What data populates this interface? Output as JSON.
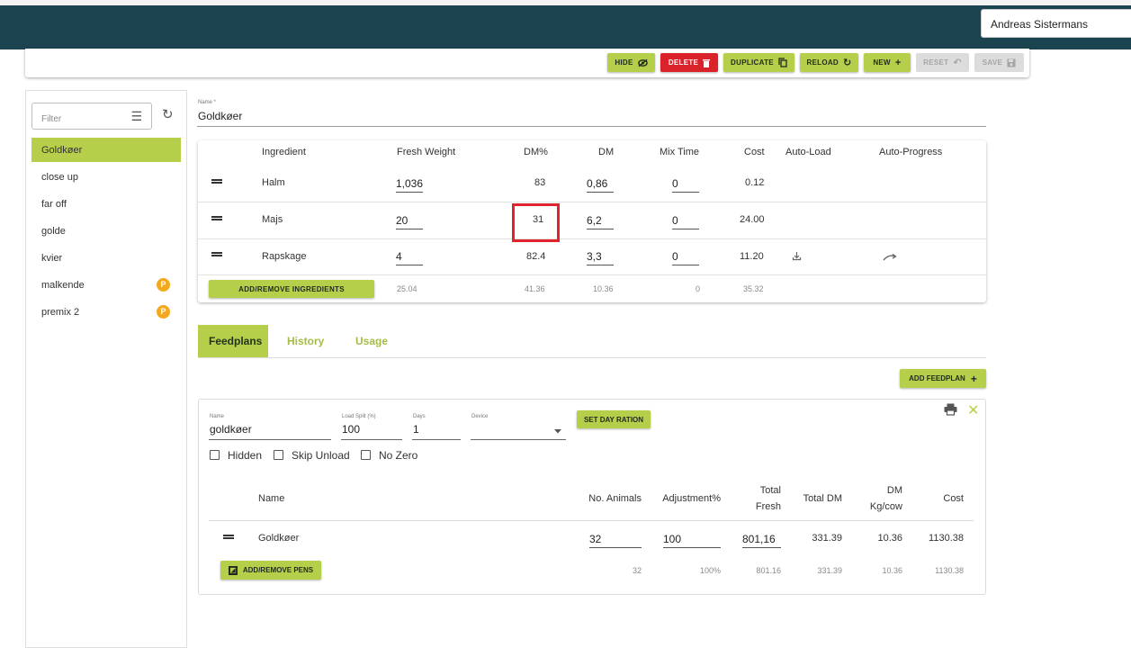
{
  "header": {
    "user_name": "Andreas Sistermans"
  },
  "toolbar": {
    "hide": "HIDE",
    "delete": "DELETE",
    "duplicate": "DUPLICATE",
    "reload": "RELOAD",
    "new": "NEW",
    "reset": "RESET",
    "save": "SAVE"
  },
  "sidebar": {
    "filter_placeholder": "Filter",
    "items": [
      {
        "label": "Goldkøer"
      },
      {
        "label": "close up"
      },
      {
        "label": "far off"
      },
      {
        "label": "golde"
      },
      {
        "label": "kvier"
      },
      {
        "label": "malkende",
        "badge": "P"
      },
      {
        "label": "premix 2",
        "badge": "P"
      }
    ]
  },
  "ration": {
    "name_label": "Name *",
    "name_value": "Goldkøer",
    "columns": [
      "Ingredient",
      "Fresh Weight",
      "DM%",
      "DM",
      "Mix Time",
      "Cost",
      "Auto-Load",
      "Auto-Progress"
    ],
    "rows": [
      {
        "ingredient": "Halm",
        "fresh_weight": "1,036",
        "dm_pct": "83",
        "dm": "0,86",
        "mix_time": "0",
        "cost": "0.12"
      },
      {
        "ingredient": "Majs",
        "fresh_weight": "20",
        "dm_pct": "31",
        "dm": "6,2",
        "mix_time": "0",
        "cost": "24.00"
      },
      {
        "ingredient": "Rapskage",
        "fresh_weight": "4",
        "dm_pct": "82.4",
        "dm": "3,3",
        "mix_time": "0",
        "cost": "11.20"
      }
    ],
    "totals": {
      "fresh_weight": "25.04",
      "dm_pct": "41.36",
      "dm": "10.36",
      "mix_time": "0",
      "cost": "35.32"
    },
    "add_remove_label": "ADD/REMOVE INGREDIENTS"
  },
  "tabs": [
    {
      "label": "Feedplans",
      "active": true
    },
    {
      "label": "History"
    },
    {
      "label": "Usage"
    }
  ],
  "feedplan": {
    "add_label": "ADD FEEDPLAN",
    "name_label": "Name",
    "name_value": "goldkøer",
    "load_split_label": "Load Split (%)",
    "load_split_value": "100",
    "days_label": "Days",
    "days_value": "1",
    "device_label": "Device",
    "device_value": "",
    "set_day_ration": "SET DAY RATION",
    "checkboxes": [
      "Hidden",
      "Skip Unload",
      "No Zero"
    ],
    "columns": {
      "name": "Name",
      "animals": "No. Animals",
      "adjustment": "Adjustment%",
      "total_fresh_1": "Total",
      "total_fresh_2": "Fresh",
      "total_dm": "Total DM",
      "dm_kg_1": "DM",
      "dm_kg_2": "Kg/cow",
      "cost": "Cost"
    },
    "row": {
      "name": "Goldkøer",
      "animals": "32",
      "adjustment": "100",
      "total_fresh": "801,16",
      "total_dm": "331.39",
      "dm_kg": "10.36",
      "cost": "1130.38"
    },
    "totals": {
      "animals": "32",
      "adjustment": "100%",
      "total_fresh": "801.16",
      "total_dm": "331.39",
      "dm_kg": "10.36",
      "cost": "1130.38"
    },
    "add_pens": "ADD/REMOVE PENS"
  },
  "colors": {
    "header": "#1c4450",
    "accent": "#b6cf4a",
    "danger": "#d9222a",
    "badge": "#f2a91d",
    "highlight": "#e0242b"
  }
}
